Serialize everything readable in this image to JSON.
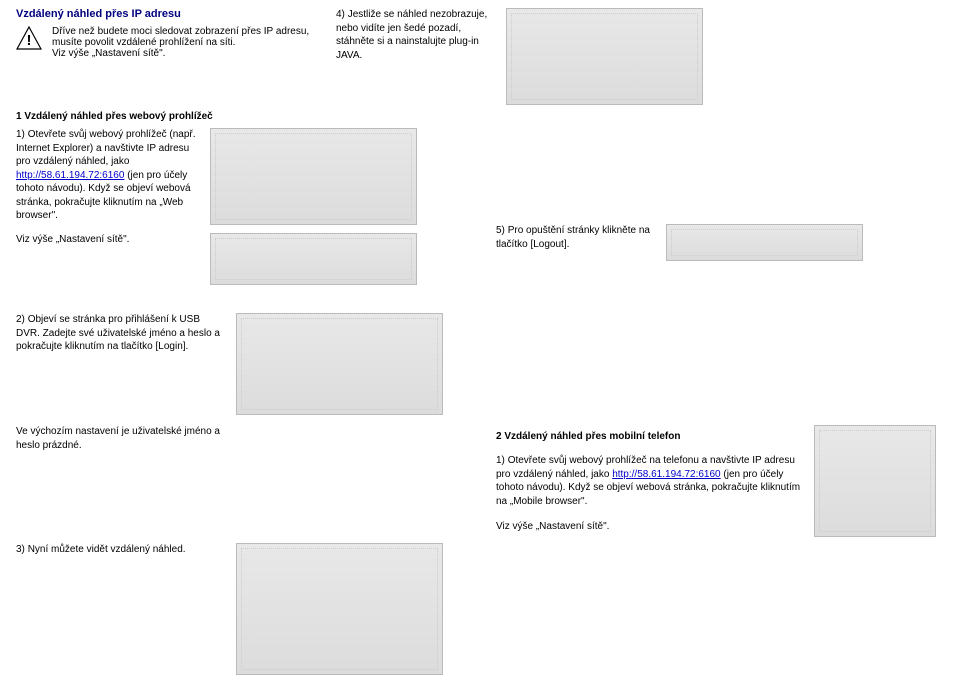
{
  "title": "Vzdálený náhled přes IP adresu",
  "warning": {
    "line1": "Dříve než budete moci sledovat zobrazení přes IP adresu,",
    "line2": "musíte povolit vzdálené prohlížení na síti.",
    "line3": "Viz výše „Nastavení sítě\"."
  },
  "section1_heading": "1 Vzdálený náhled přes webový prohlížeč",
  "step1": {
    "num": "1)",
    "p1": "Otevřete svůj webový prohlížeč (např. Internet Explorer) a navštivte IP adresu pro vzdálený náhled, jako ",
    "link": "http://58.61.194.72:6160",
    "p2": " (jen pro účely tohoto návodu). Když se objeví webová stránka, pokračujte kliknutím na „Web browser\"."
  },
  "note_under_step1": "Viz výše „Nastavení sítě\".",
  "step2": {
    "num": "2)",
    "text": "Objeví se stránka pro přihlášení k USB DVR. Zadejte své uživatelské jméno a heslo a pokračujte kliknutím na tlačítko [Login]."
  },
  "step2b": "Ve výchozím nastavení je uživatelské jméno a heslo prázdné.",
  "step3": {
    "num": "3)",
    "text": "Nyní můžete vidět vzdálený náhled."
  },
  "step4": {
    "num": "4)",
    "text": "Jestliže se náhled nezobrazuje, nebo vidíte jen šedé pozadí, stáhněte si a nainstalujte plug-in JAVA."
  },
  "step5": {
    "num": "5)",
    "text": "Pro opuštění stránky klikněte na tlačítko [Logout]."
  },
  "section2_heading": "2 Vzdálený náhled přes mobilní telefon",
  "mobile_step1": {
    "num": "1)",
    "p1": "Otevřete svůj webový prohlížeč na telefonu a navštivte IP adresu pro vzdálený náhled, jako ",
    "link": "http://58.61.194.72:6160",
    "p2": " (jen pro účely tohoto návodu). Když se objeví webová stránka, pokračujte kliknutím na „Mobile browser\"."
  },
  "mobile_note": "Viz výše „Nastavení sítě\"."
}
